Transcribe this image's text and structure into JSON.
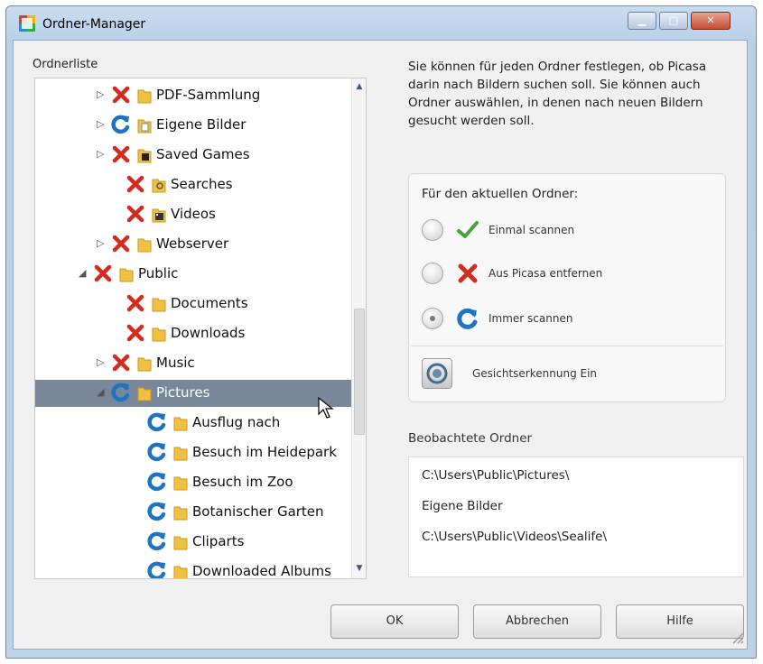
{
  "window": {
    "title": "Ordner-Manager"
  },
  "tree": {
    "label": "Ordnerliste",
    "items": [
      {
        "label": "PDF-Sammlung",
        "status": "x-icon",
        "expander": "▷",
        "folder": "yellow"
      },
      {
        "label": "Eigene Bilder",
        "status": "refresh-icon",
        "expander": "▷",
        "folder": "doc"
      },
      {
        "label": "Saved Games",
        "status": "x-icon",
        "expander": "▷",
        "folder": "games"
      },
      {
        "label": "Searches",
        "status": "x-icon",
        "expander": "",
        "folder": "search"
      },
      {
        "label": "Videos",
        "status": "x-icon",
        "expander": "",
        "folder": "video"
      },
      {
        "label": "Webserver",
        "status": "x-icon",
        "expander": "▷",
        "folder": "yellow"
      },
      {
        "label": "Public",
        "status": "x-icon",
        "expander": "◢",
        "folder": "yellow"
      },
      {
        "label": "Documents",
        "status": "x-icon",
        "expander": "",
        "folder": "yellow"
      },
      {
        "label": "Downloads",
        "status": "x-icon",
        "expander": "",
        "folder": "yellow"
      },
      {
        "label": "Music",
        "status": "x-icon",
        "expander": "▷",
        "folder": "yellow"
      },
      {
        "label": "Pictures",
        "status": "refresh-icon",
        "expander": "◢",
        "folder": "yellow",
        "selected": true
      },
      {
        "label": "Ausflug nach",
        "status": "refresh-icon",
        "expander": "",
        "folder": "yellow"
      },
      {
        "label": "Besuch im Heidepark",
        "status": "refresh-icon",
        "expander": "",
        "folder": "yellow"
      },
      {
        "label": "Besuch im Zoo",
        "status": "refresh-icon",
        "expander": "",
        "folder": "yellow"
      },
      {
        "label": "Botanischer Garten",
        "status": "refresh-icon",
        "expander": "",
        "folder": "yellow"
      },
      {
        "label": "Cliparts",
        "status": "refresh-icon",
        "expander": "",
        "folder": "yellow"
      },
      {
        "label": "Downloaded Albums",
        "status": "refresh-icon",
        "expander": "",
        "folder": "yellow"
      }
    ]
  },
  "info": {
    "text": "Sie können für jeden Ordner festlegen, ob Picasa darin nach Bildern suchen soll. Sie können auch Ordner auswählen, in denen nach neuen Bildern gesucht werden soll."
  },
  "current_folder": {
    "heading": "Für den aktuellen Ordner:",
    "options": [
      {
        "label": "Einmal scannen",
        "icon": "check-icon",
        "selected": false
      },
      {
        "label": "Aus Picasa entfernen",
        "icon": "x-icon",
        "selected": false
      },
      {
        "label": "Immer scannen",
        "icon": "refresh-icon",
        "selected": true
      }
    ],
    "face_recognition": {
      "label": "Gesichtserkennung Ein",
      "icon": "face-recognition-icon"
    }
  },
  "watched": {
    "label": "Beobachtete Ordner",
    "items": [
      "C:\\Users\\Public\\Pictures\\",
      "Eigene Bilder",
      "C:\\Users\\Public\\Videos\\Sealife\\"
    ]
  },
  "buttons": {
    "ok": "OK",
    "cancel": "Abbrechen",
    "help": "Hilfe"
  },
  "colors": {
    "selection": "#788799",
    "x_red": "#d42a20",
    "refresh_blue": "#1f73c4",
    "check_green": "#4aa33a",
    "folder_yellow": "#f0c040"
  }
}
